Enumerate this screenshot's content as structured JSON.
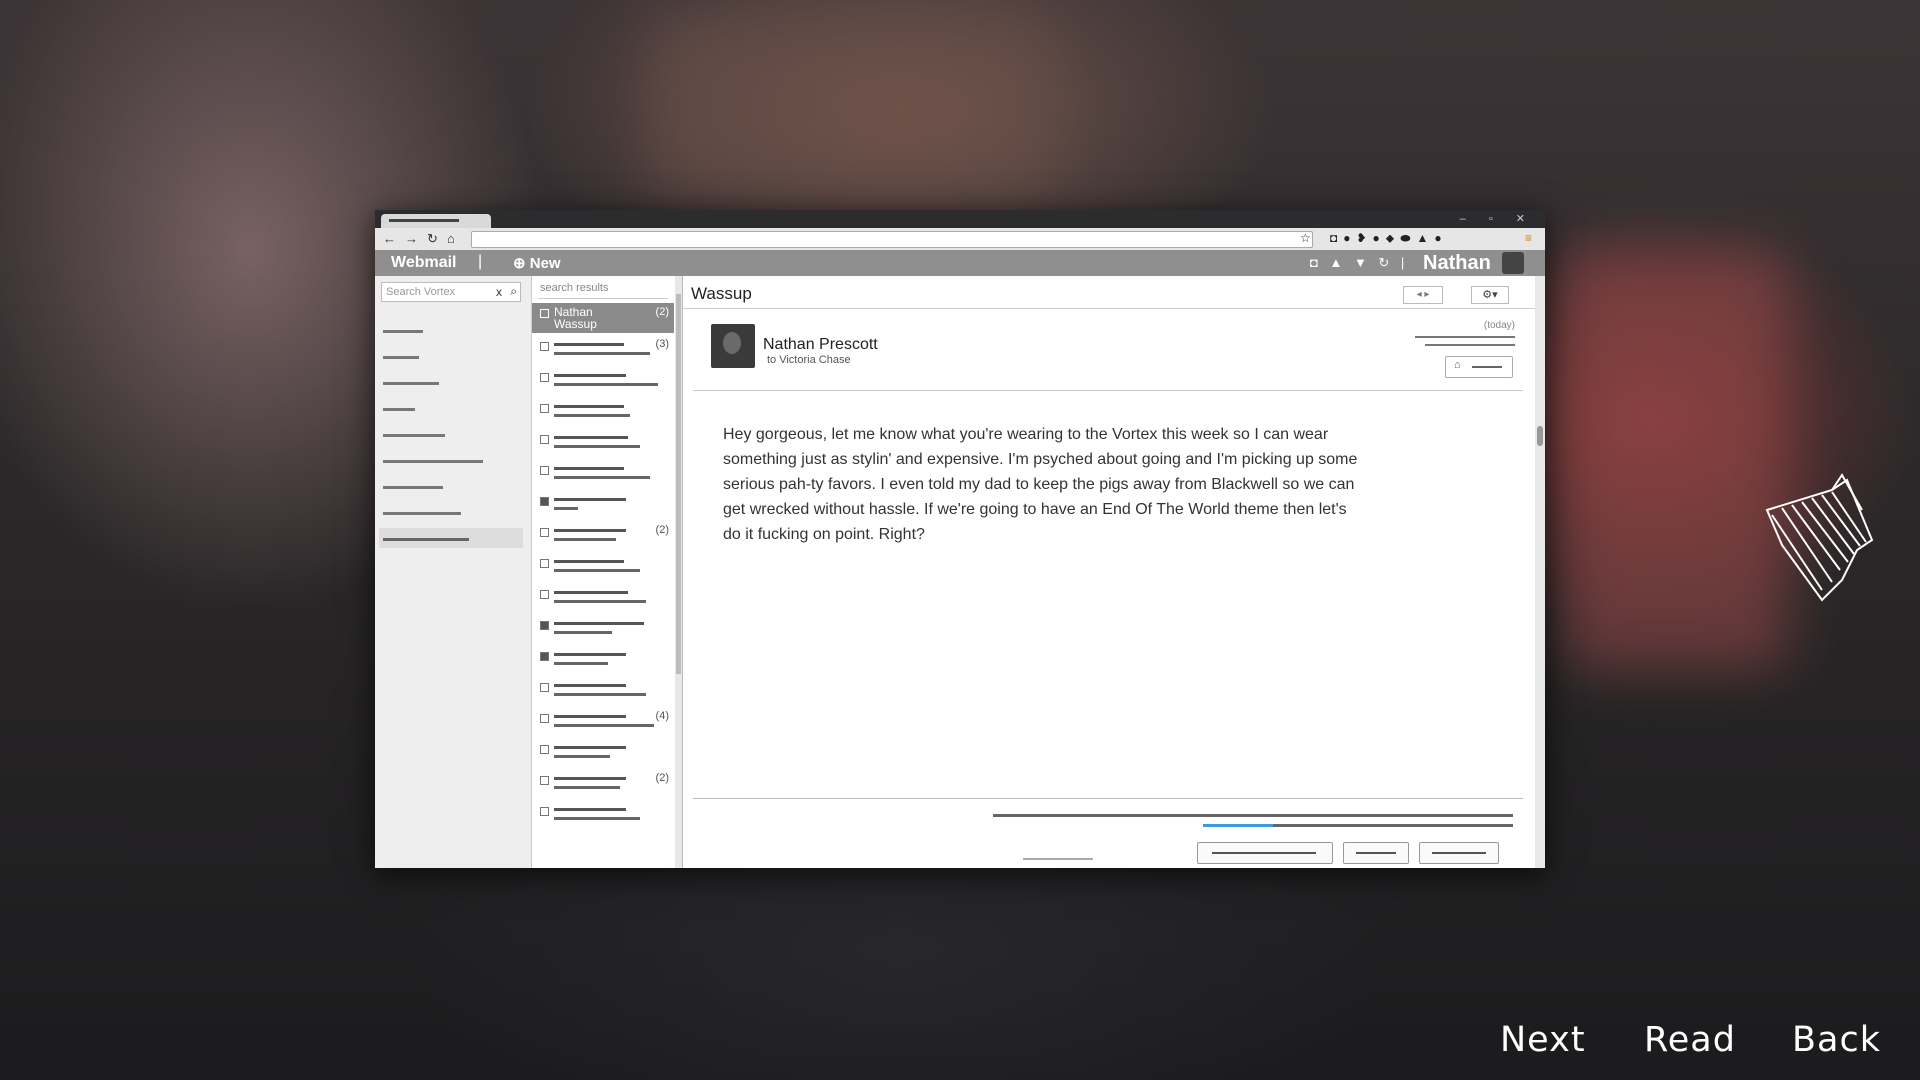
{
  "window": {
    "controls": "– ▫ ✕"
  },
  "app": {
    "brand": "Webmail",
    "separator": "|",
    "new_label": "⊕ New",
    "user_name": "Nathan"
  },
  "sidebar": {
    "search_placeholder": "Search Vortex",
    "clear_icon": "x",
    "search_icon": "⌕"
  },
  "list": {
    "header": "search results",
    "selected": {
      "name": "Nathan\nWassup",
      "count": "(2)"
    },
    "counts": [
      "(3)",
      "(2)",
      "(4)",
      "(2)"
    ]
  },
  "message": {
    "subject": "Wassup",
    "sender": "Nathan Prescott",
    "recipient": "to Victoria Chase",
    "date": "(today)",
    "body": "Hey gorgeous, let me know what you're wearing to the Vortex this week so I can wear something just as stylin' and expensive. I'm psyched about going and I'm picking up some serious pah-ty favors. I even told my dad to keep the pigs away from Blackwell so we can get wrecked without hassle. If we're going to have an End Of The World theme then let's do it fucking on point. Right?"
  },
  "hud": {
    "next": "Next",
    "read": "Read",
    "back": "Back"
  }
}
